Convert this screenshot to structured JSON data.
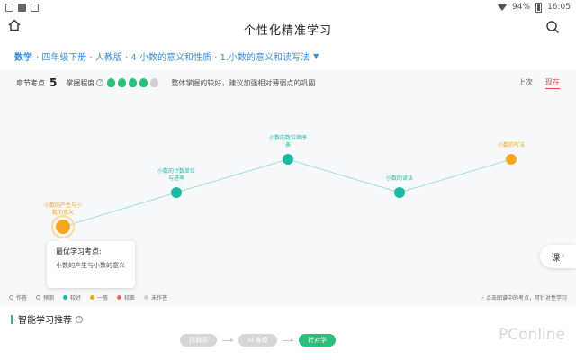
{
  "status_bar": {
    "battery": "94%",
    "time": "16:05"
  },
  "header": {
    "title": "个性化精准学习"
  },
  "breadcrumb": {
    "subject": "数学",
    "path": "· 四年级下册 · 人教版 · 4 小数的意义和性质 · 1.小数的意义和读写法"
  },
  "summary": {
    "points_label": "章节考点",
    "points_count": "5",
    "mastery_label": "掌握程度",
    "mastery_bulbs": 4,
    "mastery_total": 5,
    "mastery_text": "整体掌握的较好，建议加强相对薄弱点的巩固"
  },
  "tabs": [
    {
      "label": "上次"
    },
    {
      "label": "现在"
    }
  ],
  "graph_nodes": [
    {
      "label_lines": [
        "小数的产生与小",
        "数的意义"
      ],
      "status": "一般",
      "color": "#f5a623"
    },
    {
      "label_lines": [
        "小数的计数单位",
        "与进率"
      ],
      "status": "较好",
      "color": "#1bb9a3"
    },
    {
      "label_lines": [
        "小数的数位顺序",
        "表"
      ],
      "status": "较好",
      "color": "#1bb9a3"
    },
    {
      "label_lines": [
        "小数的读法"
      ],
      "status": "较好",
      "color": "#1bb9a3"
    },
    {
      "label_lines": [
        "小数的写法"
      ],
      "status": "一般",
      "color": "#f5a623"
    }
  ],
  "tooltip": {
    "title": "最优学习考点:",
    "text": "小数的产生与小数的意义"
  },
  "course_button": {
    "label": "课"
  },
  "legend": [
    {
      "label": "作答",
      "color": "#999999",
      "style": "hollow"
    },
    {
      "label": "预测",
      "color": "#999999",
      "style": "hollow"
    },
    {
      "label": "较好",
      "color": "#1bb9a3",
      "style": "fill"
    },
    {
      "label": "一般",
      "color": "#f5a623",
      "style": "fill"
    },
    {
      "label": "较差",
      "color": "#f06b5a",
      "style": "fill"
    },
    {
      "label": "未作答",
      "color": "#d0d0d0",
      "style": "fill"
    }
  ],
  "hint": "点击图谱中的考点，可针对性学习",
  "recommend": {
    "title": "智能学习推荐"
  },
  "steps": [
    {
      "label": "找弱项"
    },
    {
      "label": "Ai 推荐"
    },
    {
      "label": "针对学"
    }
  ],
  "watermark": "PConline"
}
